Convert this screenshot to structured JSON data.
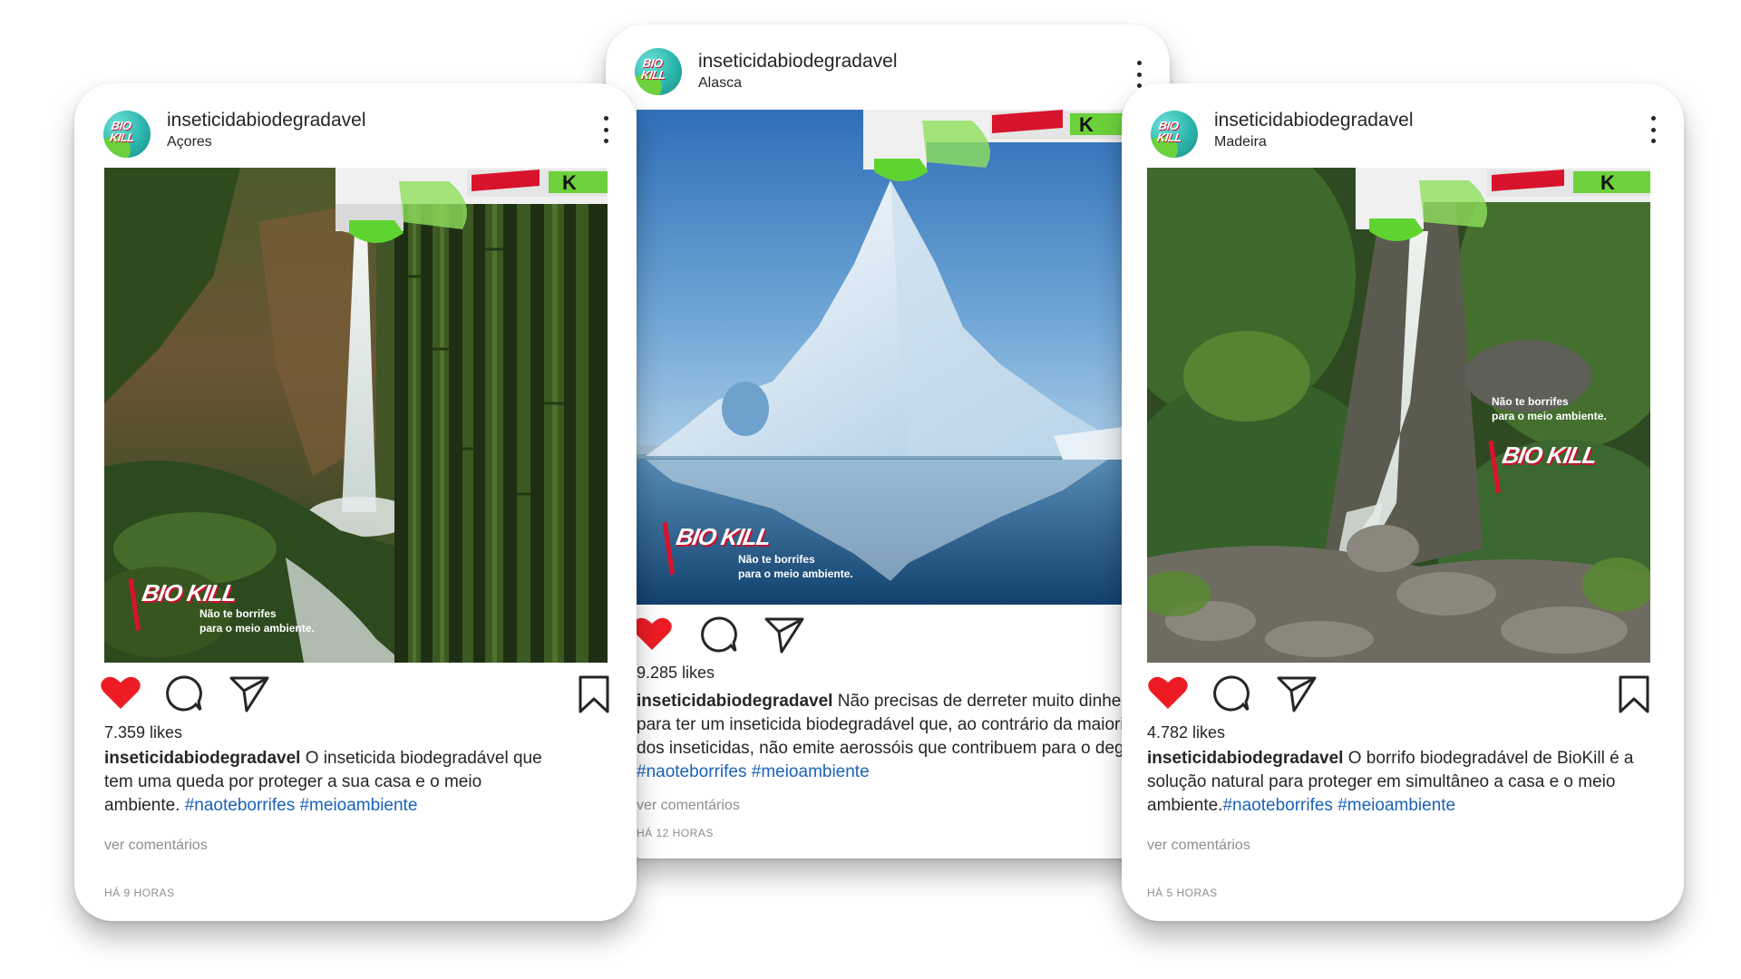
{
  "posts": [
    {
      "username": "inseticidabiodegradavel",
      "location": "Açores",
      "avatar_text": "BIO KILL",
      "overlay_text": "Não te borrifes\npara o meio ambiente.",
      "logo_text": "BIO KILL",
      "likes": "7.359 likes",
      "caption_user": "inseticidabiodegradavel",
      "caption_text": " O inseticida biodegradável que tem uma queda por proteger a sua casa e o meio ambiente. ",
      "hashtags": "#naoteborrifes #meioambiente",
      "comments_label": "ver comentários",
      "time": "HÁ 9 HORAS",
      "liked": true
    },
    {
      "username": "inseticidabiodegradavel",
      "location": "Alasca",
      "avatar_text": "BIO KILL",
      "overlay_text": "Não te borrifes\npara o meio ambiente.",
      "logo_text": "BIO KILL",
      "likes": "9.285 likes",
      "caption_user": "inseticidabiodegradavel",
      "caption_text": " Não precisas de derreter muito dinheiro para ter um inseticida biodegradável que, ao contrário da maioria dos inseticidas, não emite aerossóis que contribuem para o degelo. ",
      "hashtags": "#naoteborrifes #meioambiente",
      "comments_label": "ver comentários",
      "time": "HÁ 12 HORAS",
      "liked": true
    },
    {
      "username": "inseticidabiodegradavel",
      "location": "Madeira",
      "avatar_text": "BIO KILL",
      "overlay_text": "Não te borrifes\npara o meio ambiente.",
      "logo_text": "BIO KILL",
      "likes": "4.782 likes",
      "caption_user": "inseticidabiodegradavel",
      "caption_text": " O borrifo biodegradável de BioKill é a solução natural para proteger em simultâneo a casa e o meio ambiente.",
      "hashtags": "#naoteborrifes #meioambiente",
      "comments_label": "ver comentários",
      "time": "HÁ 5 HORAS",
      "liked": true
    }
  ],
  "icons": {
    "like": "heart-icon",
    "comment": "comment-icon",
    "share": "send-icon",
    "save": "bookmark-icon",
    "more": "more-options-icon"
  },
  "colors": {
    "like_red": "#ed1c24",
    "hashtag_blue": "#1a62b8",
    "brand_red": "#d7142b",
    "brand_green": "#6cd13b"
  }
}
